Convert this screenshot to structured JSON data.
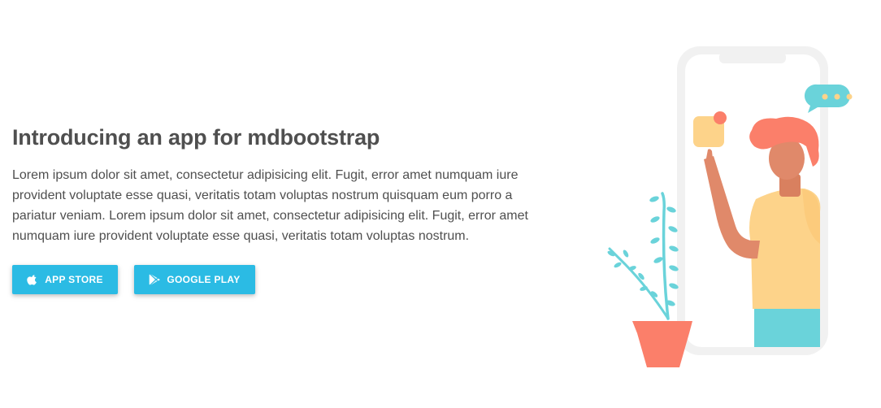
{
  "hero": {
    "title": "Introducing an app for mdbootstrap",
    "description": "Lorem ipsum dolor sit amet, consectetur adipisicing elit. Fugit, error amet numquam iure provident voluptate esse quasi, veritatis totam voluptas nostrum quisquam eum porro a pariatur veniam. Lorem ipsum dolor sit amet, consectetur adipisicing elit. Fugit, error amet numquam iure provident voluptate esse quasi, veritatis totam voluptas nostrum."
  },
  "buttons": {
    "app_store": {
      "label": "APP STORE",
      "icon": "apple-icon"
    },
    "google_play": {
      "label": "GOOGLE PLAY",
      "icon": "google-play-icon"
    }
  },
  "colors": {
    "accent": "#2bbbe4",
    "text": "#4f4f4f",
    "phone_frame": "#f1f1f1",
    "skin": "#e0896a",
    "hair": "#fb7f6a",
    "shirt": "#fdd38a",
    "pants": "#6ad3da",
    "plant": "#6ad3da",
    "pot": "#fb7f6a"
  }
}
